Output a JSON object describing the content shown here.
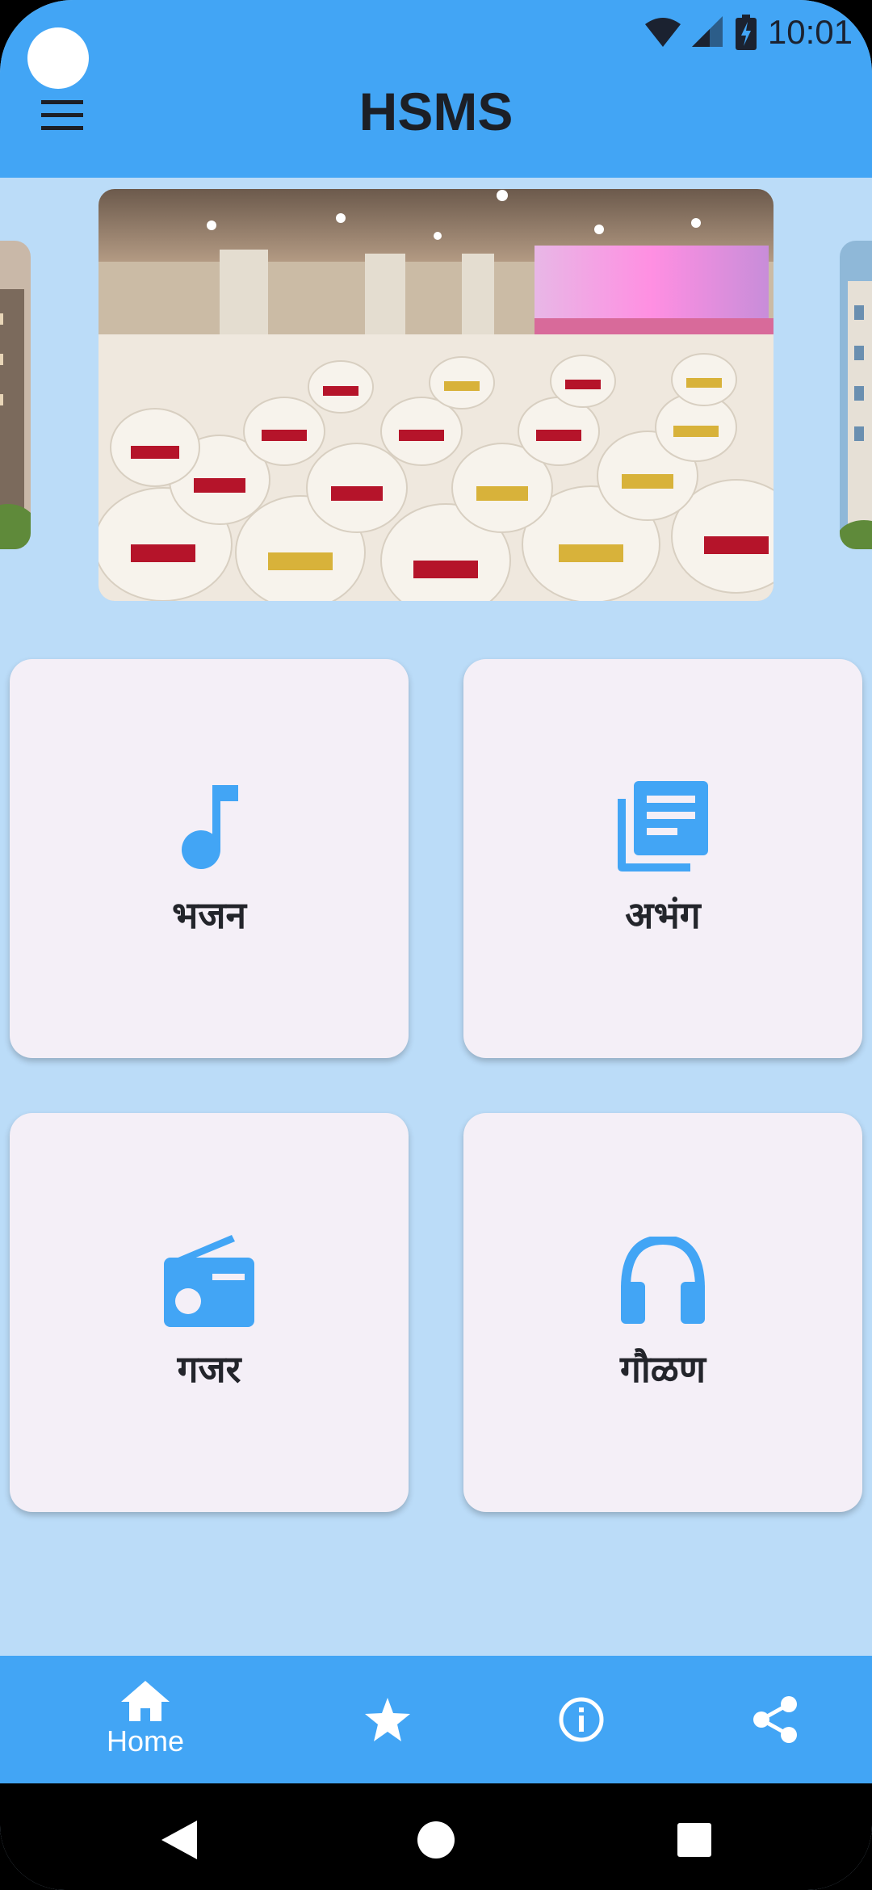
{
  "app": {
    "title": "HSMS"
  },
  "status_bar": {
    "time": "10:01",
    "icons": [
      "wifi-icon",
      "signal-icon",
      "battery-icon"
    ]
  },
  "header": {
    "menu_icon": "menu-icon"
  },
  "carousel": {
    "slides": [
      {
        "name": "building-image-left",
        "kind": "photo"
      },
      {
        "name": "banquet-hall-image",
        "kind": "photo"
      },
      {
        "name": "building-image-right",
        "kind": "photo"
      }
    ]
  },
  "tiles": [
    {
      "label": "भजन",
      "icon": "music-note-icon"
    },
    {
      "label": "अभंग",
      "icon": "library-books-icon"
    },
    {
      "label": "गजर",
      "icon": "radio-icon"
    },
    {
      "label": "गौळण",
      "icon": "headphones-icon"
    }
  ],
  "bottom_nav": {
    "items": [
      {
        "label": "Home",
        "icon": "home-icon"
      },
      {
        "label": "",
        "icon": "star-icon"
      },
      {
        "label": "",
        "icon": "info-icon"
      },
      {
        "label": "",
        "icon": "share-icon"
      }
    ]
  },
  "system_nav": {
    "items": [
      "back-icon",
      "home-circle-icon",
      "recents-icon"
    ]
  },
  "colors": {
    "primary": "#42a5f5",
    "background": "#bbdcf8",
    "tile": "#f4eff7",
    "text": "#23252b"
  }
}
